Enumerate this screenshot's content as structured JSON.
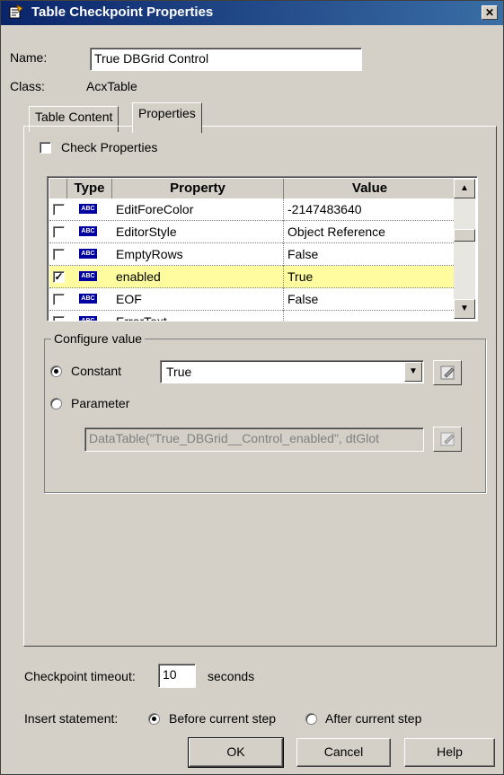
{
  "window": {
    "title": "Table Checkpoint Properties",
    "close_glyph": "✕"
  },
  "fields": {
    "name_label": "Name:",
    "name_value": "True DBGrid  Control",
    "class_label": "Class:",
    "class_value": "AcxTable"
  },
  "tabs": [
    {
      "label": "Table Content",
      "active": false
    },
    {
      "label": "Properties",
      "active": true
    }
  ],
  "check_properties": {
    "label": "Check Properties",
    "checked": false
  },
  "grid": {
    "columns": [
      "Type",
      "Property",
      "Value"
    ],
    "rows": [
      {
        "checked": false,
        "type_icon": "abc-icon",
        "property": "EditForeColor",
        "value": "-2147483640"
      },
      {
        "checked": false,
        "type_icon": "abc-icon",
        "property": "EditorStyle",
        "value": "Object Reference"
      },
      {
        "checked": false,
        "type_icon": "abc-icon",
        "property": "EmptyRows",
        "value": "False"
      },
      {
        "checked": true,
        "type_icon": "abc-icon",
        "property": "enabled",
        "value": "True",
        "selected": true
      },
      {
        "checked": false,
        "type_icon": "abc-icon",
        "property": "EOF",
        "value": "False"
      },
      {
        "checked": false,
        "type_icon": "abc-icon",
        "property": "ErrorText",
        "value": ""
      }
    ],
    "abc_text": "ABC",
    "check_mark": "✓"
  },
  "configure": {
    "legend": "Configure value",
    "constant_label": "Constant",
    "constant_value": "True",
    "constant_selected": true,
    "parameter_label": "Parameter",
    "parameter_value": "DataTable(\"True_DBGrid__Control_enabled\", dtGlot"
  },
  "timeout": {
    "label": "Checkpoint timeout:",
    "value": "10",
    "unit": "seconds"
  },
  "insert": {
    "label": "Insert statement:",
    "before_label": "Before current step",
    "after_label": "After current step",
    "selected": "before"
  },
  "buttons": {
    "ok": "OK",
    "cancel": "Cancel",
    "help": "Help"
  },
  "colors": {
    "title_start": "#0a246a",
    "title_end": "#3a6ea5",
    "selected_row": "#fefc9e",
    "face": "#d4d0c8"
  }
}
